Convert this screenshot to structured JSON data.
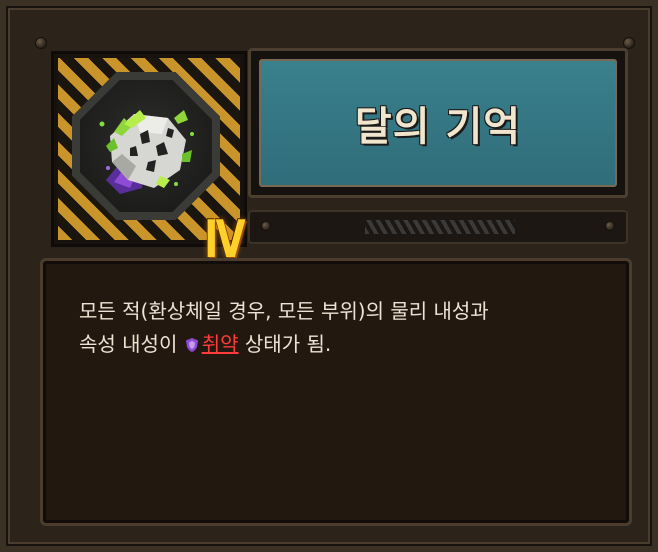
{
  "item": {
    "title": "달의 기억",
    "tier": "IV",
    "icon": "moon-ore-crystal-icon"
  },
  "description": {
    "line1": "모든 적(환상체일 경우, 모든 부위)의 물리 내성과",
    "line2_prefix": "속성 내성이",
    "status_icon": "shield-icon",
    "status_word": "취약",
    "line2_suffix": "상태가 됨."
  },
  "colors": {
    "title_plate": "#2f6d79",
    "tier_gold": "#ffcf2a",
    "status_red": "#ff3b3b",
    "status_icon_purple": "#8e4bd6"
  }
}
